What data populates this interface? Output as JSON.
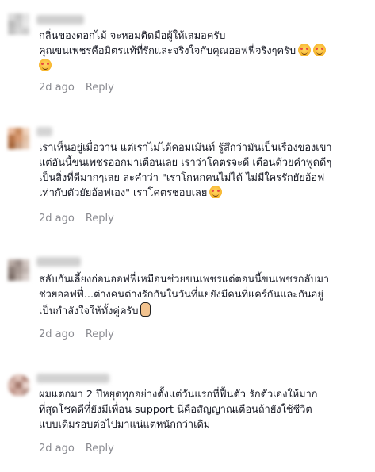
{
  "comments": [
    {
      "username": "user",
      "lines": [
        "กลิ่นของดอกไม้ จะหอมติดมือผู้ให้เสมอครับ",
        "คุณขนเพชรคือมิตรแท้ที่รักและจริงใจกับคุณออฟฟี่จริงๆครับ",
        ""
      ],
      "emoji_line": 1,
      "emoji_count": 2,
      "extra_emoji_line": 2,
      "time": "2d ago",
      "reply": "Reply",
      "avatar_colors": [
        "#dcdcdc",
        "#c9c9c9",
        "#e4e4e4",
        "#bdbdbd",
        "#d0d0d0",
        "#e8e8e8",
        "#c4c4c4",
        "#d8d8d8",
        "#cfcfcf"
      ]
    },
    {
      "username": "user",
      "lines": [
        "เราเห็นอยู่เมื่อวาน แต่เราไม่ได้คอมเม้นท์ รู้สึกว่ามันเป็นเรื่องของเขา",
        "แต่อันนี้ขนเพชรออกมาเตือนเลย เราว่าโคตรจะดี เตือนด้วยคำพูดดีๆ",
        "เป็นสิ่งที่ดีมากๆเลย ละคำว่า \"เราโกหกคนไม่ได้ ไม่มีใครรักยัยอ้อฟ",
        "เท่ากับตัวยัยอ้อฟเอง\" เราโคตรชอบเลย"
      ],
      "emoji_line": 3,
      "emoji_count": 1,
      "time": "2d ago",
      "reply": "Reply",
      "avatar_colors": [
        "#e8b89a",
        "#c98a5e",
        "#f0d2bc",
        "#b9764a",
        "#d89a72",
        "#e2c0a4",
        "#a8683e",
        "#caa083",
        "#e6c8b2"
      ]
    },
    {
      "username": "user",
      "lines": [
        "สลับกันเลี้ยงก่อนออฟฟี่เหมือนช่วยขนเพชรแต่ตอนนี้ขนเพชรกลับมา",
        "ช่วยออฟฟี่...ต่างคนต่างรักกันในวันที่แย่ยังมีคนที่แคร์กันและกันอยู่",
        "เป็นกำลังใจให้ทั้งคู่ครับ"
      ],
      "hand_line": 2,
      "time": "2d ago",
      "reply": "Reply",
      "avatar_colors": [
        "#b8aaa4",
        "#9d8f8a",
        "#cfc4bf",
        "#8e807a",
        "#a89a94",
        "#c2b6b1",
        "#7f716b",
        "#b4a7a1",
        "#d6ccc8"
      ]
    },
    {
      "username": "user",
      "lines": [
        "ผมแตกมา 2 ปีหยุดทุกอย่างตั้งแต่วันแรกที่ฟื้นตัว รักตัวเองให้มาก",
        "ที่สุดโชคดีที่ยังมีเพื่อน support นี่คือสัญญาณเตือนถ้ายังใช้ชีวิต",
        "แบบเดิมรอบต่อไปมาแน่แต่หนักกว่าเดิม"
      ],
      "time": "2d ago",
      "reply": "Reply",
      "avatar_colors": [
        "#c9a59b",
        "#e0c4bb",
        "#b58a7e",
        "#d7b5ab",
        "#a67b6f",
        "#e9d3cc",
        "#c09488",
        "#d2aea4",
        "#b9968c"
      ]
    }
  ]
}
